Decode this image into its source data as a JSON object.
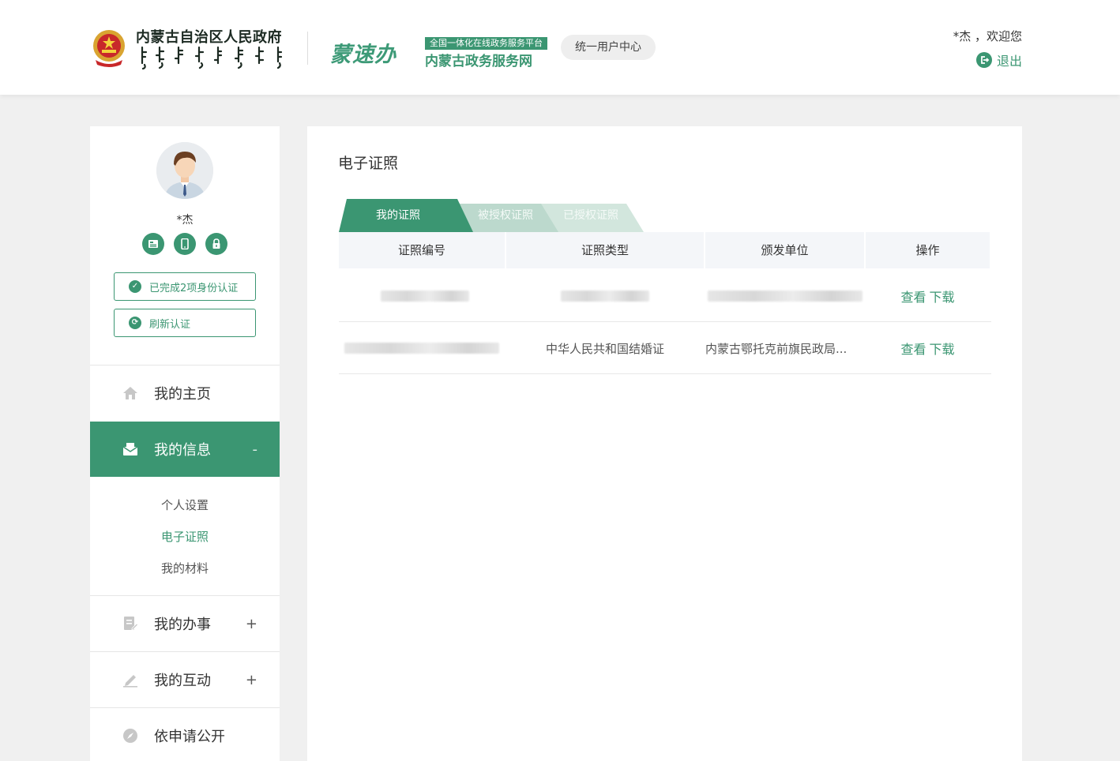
{
  "header": {
    "gov_title": "内蒙古自治区人民政府",
    "brand_calligraphy": "蒙速办",
    "brand_tag": "全国一体化在线政务服务平台",
    "brand_name": "内蒙古政务服务网",
    "user_center": "统一用户中心",
    "welcome": "*杰 ，欢迎您",
    "logout": "退出"
  },
  "sidebar": {
    "user_name": "*杰",
    "auth_done": "已完成2项身份认证",
    "auth_refresh": "刷新认证",
    "menu": [
      {
        "label": "我的主页"
      },
      {
        "label": "我的信息",
        "toggle": "-"
      },
      {
        "label": "我的办事",
        "toggle": "+"
      },
      {
        "label": "我的互动",
        "toggle": "+"
      },
      {
        "label": "依申请公开"
      }
    ],
    "submenu": [
      "个人设置",
      "电子证照",
      "我的材料"
    ]
  },
  "main": {
    "title": "电子证照",
    "tabs": [
      "我的证照",
      "被授权证照",
      "已授权证照"
    ],
    "columns": [
      "证照编号",
      "证照类型",
      "颁发单位",
      "操作"
    ],
    "rows": [
      {
        "number": "",
        "type": "",
        "issuer": "",
        "view": "查看",
        "download": "下载"
      },
      {
        "number": "",
        "type": "中华人民共和国结婚证",
        "issuer": "内蒙古鄂托克前旗民政局...",
        "view": "查看",
        "download": "下载"
      }
    ]
  },
  "colors": {
    "accent": "#3b9672",
    "tab_inactive": "#bcd9cd"
  }
}
